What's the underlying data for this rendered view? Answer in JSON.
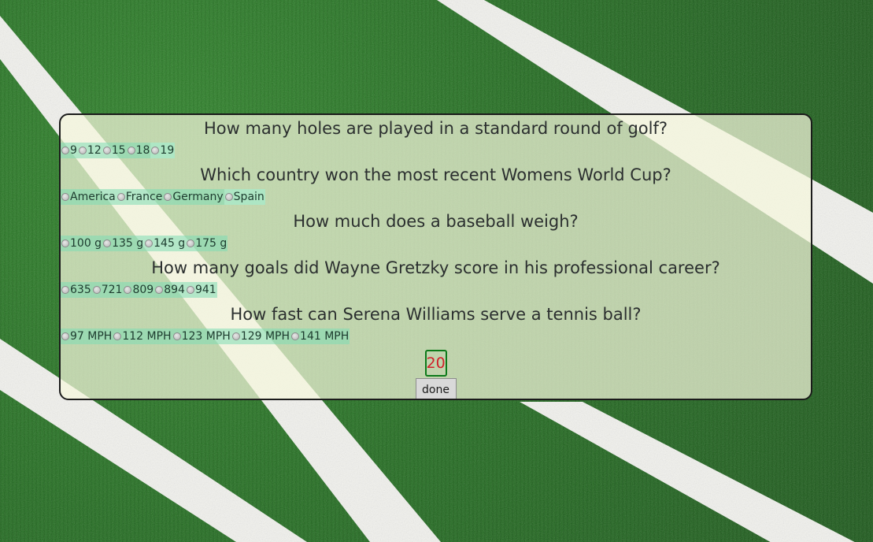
{
  "questions": [
    {
      "text": "How many holes are played in a standard round of golf?",
      "options": [
        "9",
        "12",
        "15",
        "18",
        "19"
      ]
    },
    {
      "text": "Which country won the most recent Womens World Cup?",
      "options": [
        "America",
        "France",
        "Germany",
        "Spain"
      ]
    },
    {
      "text": "How much does a baseball weigh?",
      "options": [
        "100 g",
        "135 g",
        "145 g",
        "175 g"
      ]
    },
    {
      "text": "How many goals did Wayne Gretzky score in his professional career?",
      "options": [
        "635",
        "721",
        "809",
        "894",
        "941"
      ]
    },
    {
      "text": "How fast can Serena Williams serve a tennis ball?",
      "options": [
        "97 MPH",
        "112 MPH",
        "123 MPH",
        "129 MPH",
        "141 MPH"
      ]
    }
  ],
  "timer": {
    "value": "20",
    "color": "#d0202a",
    "border_color": "#0c7a1a"
  },
  "done_button": {
    "label": "done"
  },
  "colors": {
    "panel_bg": "#f5f7dc",
    "option_highlight": "#7ddcb4",
    "field_green": "#1f6b1d",
    "field_lines": "#f2f2ee"
  }
}
